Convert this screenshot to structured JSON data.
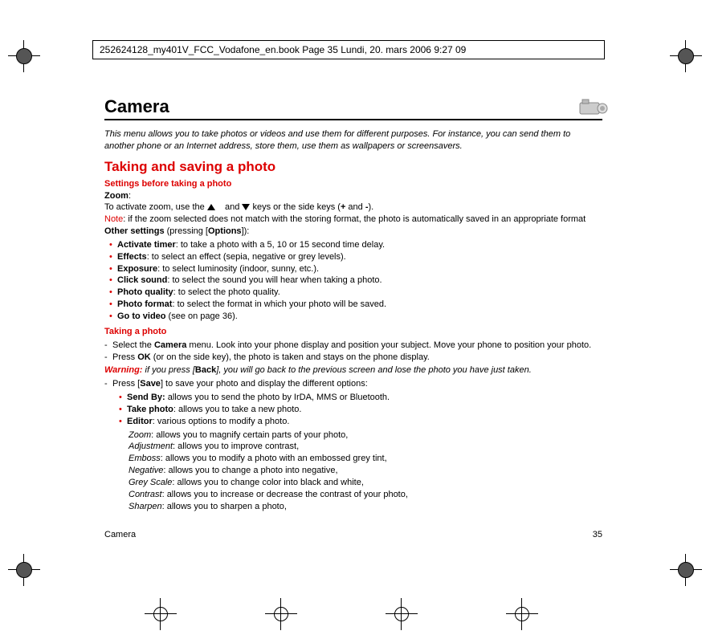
{
  "header": "252624128_my401V_FCC_Vodafone_en.book  Page 35  Lundi, 20. mars 2006  9:27 09",
  "title": "Camera",
  "intro": "This menu allows you to take photos or videos and use them for different purposes. For instance, you can send them to another phone or an Internet address, store them, use them as wallpapers or screensavers.",
  "section1": "Taking and saving a photo",
  "settings_head": "Settings before taking a photo",
  "zoom_label": "Zoom",
  "zoom_text_a": "To activate zoom, use the ",
  "zoom_text_b": " and ",
  "zoom_text_c": " keys or the side keys (",
  "zoom_plus": "+",
  "zoom_and": " and ",
  "zoom_minus": "-",
  "zoom_text_d": ").",
  "note_label": "Note",
  "note_text": ": if the zoom selected does not match with the storing format, the photo is automatically saved in an appropriate format",
  "other_label": "Other settings",
  "other_text": " (pressing [",
  "options_label": "Options",
  "other_text2": "]):",
  "settings": [
    {
      "b": "Activate timer",
      "t": ": to take a photo with a 5, 10 or 15 second time delay."
    },
    {
      "b": "Effects",
      "t": ": to select an effect (sepia, negative or grey levels)."
    },
    {
      "b": "Exposure",
      "t": ": to select luminosity (indoor, sunny, etc.)."
    },
    {
      "b": "Click sound",
      "t": ": to select the sound you will hear when taking a photo."
    },
    {
      "b": "Photo quality",
      "t": ": to select the photo quality."
    },
    {
      "b": "Photo format",
      "t": ": to select the format in which your photo will be saved."
    },
    {
      "b": "Go to video",
      "t": " (see on page 36)."
    }
  ],
  "taking_head": "Taking a photo",
  "taking": [
    {
      "pre": "Select the ",
      "b": "Camera",
      "post": " menu. Look into your phone display and position your subject. Move your phone to position your photo."
    },
    {
      "pre": "Press ",
      "b": "OK",
      "post": " (or on the side key), the photo is taken and stays on the phone display."
    }
  ],
  "warning_label": "Warning:",
  "warning_text_a": " if you press [",
  "warning_back": "Back",
  "warning_text_b": "], you will go back to the previous screen and lose the photo you have just taken.",
  "save_line_pre": "Press [",
  "save_label": "Save",
  "save_line_post": "] to save your photo and display the different options:",
  "save_opts": [
    {
      "b": "Send By:",
      "t": " allows you to send the photo by IrDA, MMS or Bluetooth."
    },
    {
      "b": "Take photo",
      "t": ": allows you to take a new photo."
    },
    {
      "b": "Editor",
      "t": ": various options to modify a photo."
    }
  ],
  "editor_opts": [
    {
      "n": "Zoom",
      "t": ": allows you to magnify certain parts of your photo,"
    },
    {
      "n": "Adjustment",
      "t": ": allows you to improve contrast,"
    },
    {
      "n": "Emboss",
      "t": ": allows you to modify a photo with an embossed grey tint,"
    },
    {
      "n": "Negative",
      "t": ": allows you to change a photo into negative,"
    },
    {
      "n": "Grey Scale",
      "t": ": allows you to change color into black and white,"
    },
    {
      "n": "Contrast",
      "t": ": allows you to increase or decrease the contrast of your photo,"
    },
    {
      "n": "Sharpen",
      "t": ": allows you to sharpen a photo,"
    }
  ],
  "footer_label": "Camera",
  "page_number": "35"
}
